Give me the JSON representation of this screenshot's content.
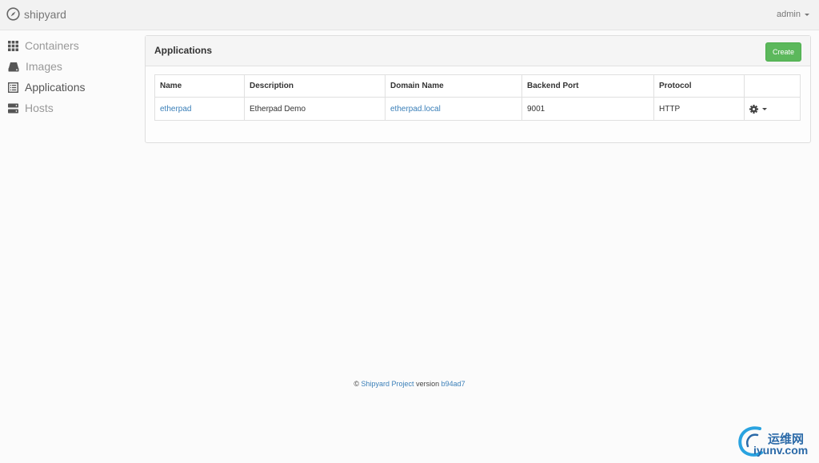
{
  "app": {
    "brand": "shipyard"
  },
  "user_menu": {
    "label": "admin"
  },
  "sidebar": {
    "items": [
      {
        "label": "Containers",
        "icon": "grid-icon",
        "active": false
      },
      {
        "label": "Images",
        "icon": "hdd-icon",
        "active": false
      },
      {
        "label": "Applications",
        "icon": "list-alt-icon",
        "active": true
      },
      {
        "label": "Hosts",
        "icon": "server-icon",
        "active": false
      }
    ]
  },
  "panel": {
    "title": "Applications",
    "create_label": "Create"
  },
  "table": {
    "headers": [
      "Name",
      "Description",
      "Domain Name",
      "Backend Port",
      "Protocol",
      ""
    ],
    "rows": [
      {
        "name": "etherpad",
        "description": "Etherpad Demo",
        "domain": "etherpad.local",
        "port": "9001",
        "protocol": "HTTP"
      }
    ]
  },
  "footer": {
    "copyright": "©",
    "project_link": "Shipyard Project",
    "version_label": "version",
    "version": "b94ad7"
  },
  "watermark": {
    "cn": "运维网",
    "en": "iyunv.com"
  },
  "colors": {
    "link": "#3a7fb8",
    "create_button": "#5cb85c"
  }
}
